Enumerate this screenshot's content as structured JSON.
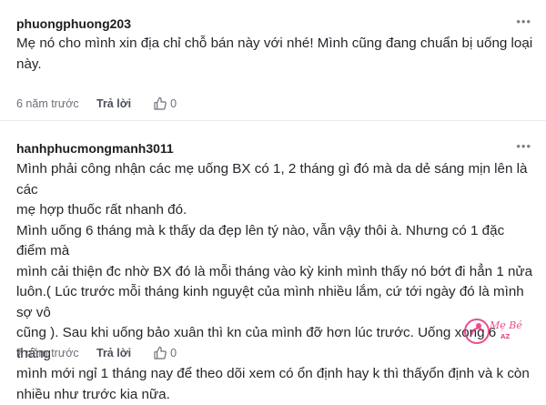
{
  "comments": [
    {
      "username": "phuongphuong203",
      "more_label": "•••",
      "text": "Mẹ nó cho mình xin địa chỉ chỗ bán này với nhé! Mình cũng đang chuẩn bị uống loại\nnày.",
      "time": "6 năm trước",
      "reply_label": "Trả lời",
      "like_count": "0"
    },
    {
      "username": "hanhphucmongmanh3011",
      "more_label": "•••",
      "text": "Mình phải công nhận các mẹ uống BX có 1, 2 tháng gì đó mà da dẻ sáng mịn lên là các\nmẹ hợp thuốc rất nhanh đó.\nMình uống 6 tháng mà k thấy da đẹp lên tý nào, vẫn vậy thôi à. Nhưng có 1 đặc điểm mà\nmình cải thiện đc nhờ BX đó là mỗi tháng vào kỳ kinh mình thấy nó bớt đi hẳn 1 nửa\nluôn.( Lúc trước mỗi tháng kinh nguyệt của mình nhiều lắm, cứ tới ngày đó là mình sợ vô\ncũng ). Sau khi uống bảo xuân thì kn của mình đỡ hơn lúc trước. Uống xong 6 tháng\nmình mới ngỉ 1 tháng nay để theo dõi xem có ổn định hay k thì thấyổn định và k còn\nnhiều như trước kia nữa.",
      "time": "7 năm trước",
      "reply_label": "Trả lời",
      "like_count": "0"
    }
  ],
  "watermark": {
    "line1": "Mẹ Bé",
    "line2": "AZ"
  },
  "colors": {
    "username": "#1c1e21",
    "meta": "#6b7079",
    "divider": "#e9eaee",
    "watermark": "#e6307a"
  },
  "icons": {
    "like": "thumbs-up-icon",
    "more": "more-horizontal-icon"
  }
}
